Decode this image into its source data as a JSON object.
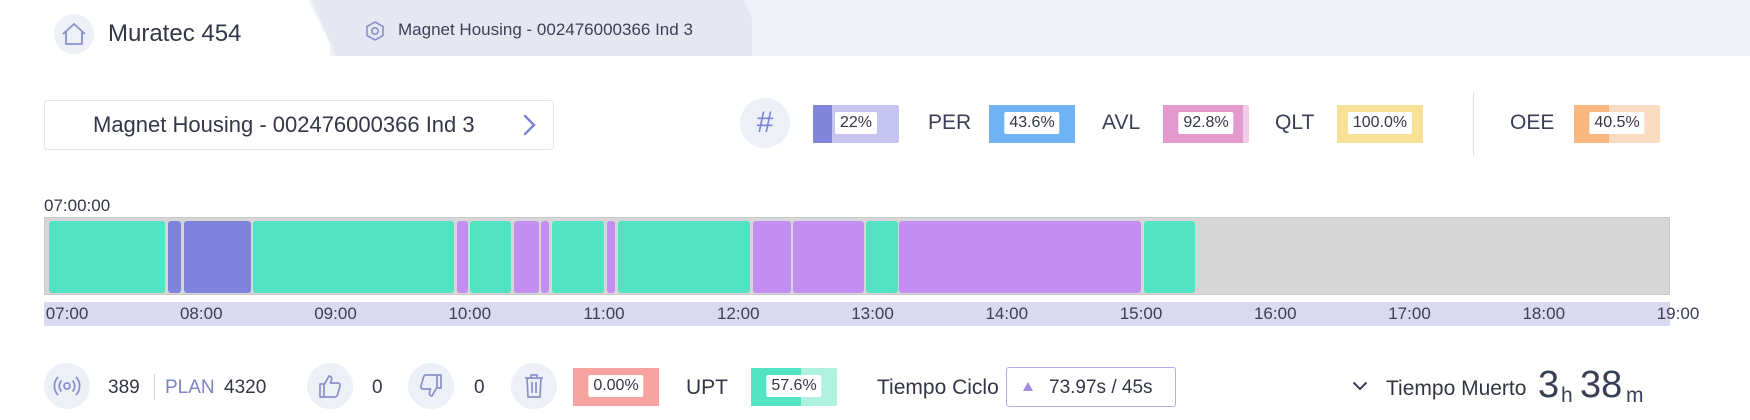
{
  "header": {
    "machine_title": "Muratec 454",
    "tab_label": "Magnet Housing - 002476000366 Ind 3"
  },
  "selector": {
    "label": "Magnet Housing - 002476000366 Ind 3"
  },
  "kpis": {
    "count_pct": {
      "value": "22%",
      "fraction": 0.22,
      "color": "#8185dc",
      "bg": "#c4c4ee"
    },
    "per": {
      "label": "PER",
      "value": "43.6%",
      "fraction": 1.0,
      "color": "#6fb2f3",
      "bg": "#6fb2f3"
    },
    "avl": {
      "label": "AVL",
      "value": "92.8%",
      "fraction": 0.928,
      "color": "#e39bce",
      "bg": "#f2cde7"
    },
    "qlt": {
      "label": "QLT",
      "value": "100.0%",
      "fraction": 1.0,
      "color": "#f8e194",
      "bg": "#f8e194"
    },
    "oee": {
      "label": "OEE",
      "value": "40.5%",
      "fraction": 0.405,
      "color": "#f8b77f",
      "bg": "#fcdcc0"
    }
  },
  "timeline": {
    "start_label": "07:00:00",
    "range_start_h": 7,
    "range_end_h": 19,
    "ticks": [
      "07:00",
      "08:00",
      "09:00",
      "10:00",
      "11:00",
      "12:00",
      "13:00",
      "14:00",
      "15:00",
      "16:00",
      "17:00",
      "18:00",
      "19:00"
    ],
    "colors": {
      "run": "#52e3c2",
      "stop": "#c28ef2",
      "setup": "#8083dc"
    },
    "segments": [
      {
        "start": 7.02,
        "end": 7.88,
        "state": "run"
      },
      {
        "start": 7.9,
        "end": 8.0,
        "state": "setup"
      },
      {
        "start": 8.02,
        "end": 8.52,
        "state": "setup"
      },
      {
        "start": 8.53,
        "end": 10.02,
        "state": "run"
      },
      {
        "start": 10.04,
        "end": 10.12,
        "state": "stop"
      },
      {
        "start": 10.14,
        "end": 10.44,
        "state": "run"
      },
      {
        "start": 10.46,
        "end": 10.65,
        "state": "stop"
      },
      {
        "start": 10.66,
        "end": 10.72,
        "state": "stop"
      },
      {
        "start": 10.74,
        "end": 11.13,
        "state": "run"
      },
      {
        "start": 11.15,
        "end": 11.21,
        "state": "stop"
      },
      {
        "start": 11.23,
        "end": 12.21,
        "state": "run"
      },
      {
        "start": 12.23,
        "end": 12.51,
        "state": "stop"
      },
      {
        "start": 12.53,
        "end": 13.05,
        "state": "stop"
      },
      {
        "start": 13.07,
        "end": 13.3,
        "state": "run"
      },
      {
        "start": 13.31,
        "end": 15.1,
        "state": "stop"
      },
      {
        "start": 15.12,
        "end": 15.5,
        "state": "run"
      }
    ]
  },
  "bottom": {
    "count": "389",
    "plan_label": "PLAN",
    "plan_value": "4320",
    "good": "0",
    "bad": "0",
    "scrap_pct": {
      "value": "0.00%",
      "color": "#f7a3a0"
    },
    "upt": {
      "label": "UPT",
      "value": "57.6%",
      "fraction": 0.576,
      "color": "#52e3c2",
      "bg": "#aef1df"
    },
    "cycle_label": "Tiempo Ciclo",
    "cycle_value": "73.97s  /  45s",
    "dead_label": "Tiempo Muerto",
    "dead_hours": "3",
    "dead_h_unit": "h",
    "dead_minutes": "38",
    "dead_m_unit": "m"
  }
}
